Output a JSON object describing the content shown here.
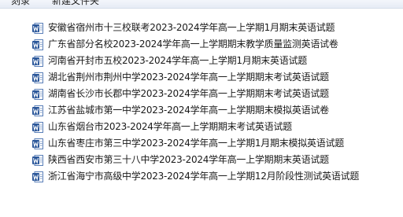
{
  "toolbar": {
    "burn_label": "刻录",
    "new_folder_label": "新建文件夹"
  },
  "icons": {
    "word_doc": "word-document-icon",
    "accent": "#2b579a"
  },
  "files": [
    {
      "name": "安徽省宿州市十三校联考2023-2024学年高一上学期1月期末英语试题"
    },
    {
      "name": "广东省部分名校2023-2024学年高一上学期期末教学质量监测英语试卷"
    },
    {
      "name": "河南省开封市五校2023-2024学年高一上学期1月期末英语试题"
    },
    {
      "name": "湖北省荆州市荆州中学2023-2024学年高一上学期期末考试英语试题"
    },
    {
      "name": "湖南省长沙市长郡中学2023-2024学年高一上学期期末考试英语试题"
    },
    {
      "name": "江苏省盐城市第一中学2023-2024学年高一上学期期末模拟英语试卷"
    },
    {
      "name": "山东省烟台市2023-2024学年高一上学期期末考试英语试题"
    },
    {
      "name": "山东省枣庄市第三中学2023-2024学年高一上学期1月期末模拟英语试题"
    },
    {
      "name": "陕西省西安市第三十八中学2023-2024学年高一上学期期末英语试题"
    },
    {
      "name": "浙江省海宁市高级中学2023-2024学年高一上学期12月阶段性测试英语试题"
    }
  ]
}
